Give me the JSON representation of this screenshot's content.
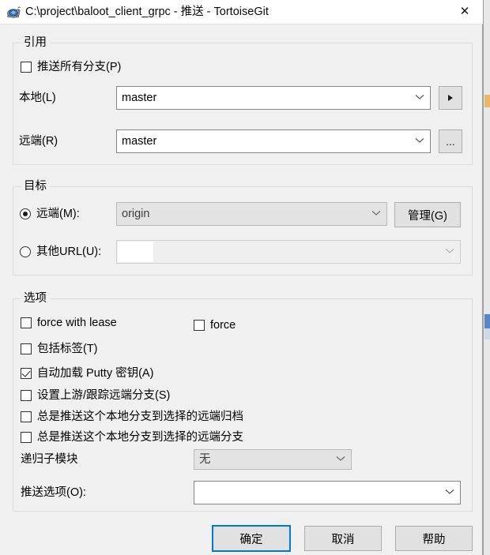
{
  "window": {
    "title": "C:\\project\\baloot_client_grpc - 推送 - TortoiseGit",
    "icon": "tortoisegit-turtle-icon",
    "close_label": "✕"
  },
  "refs_group": {
    "legend": "引用",
    "push_all_branches": {
      "label": "推送所有分支(P)",
      "checked": false
    },
    "local": {
      "label": "本地(L)",
      "value": "master",
      "button_label": "▶"
    },
    "remote": {
      "label": "远端(R)",
      "value": "master",
      "button_label": "..."
    }
  },
  "destination_group": {
    "legend": "目标",
    "remote_radio": {
      "label": "远端(M):",
      "selected": true,
      "value": "origin"
    },
    "manage_button": "管理(G)",
    "url_radio": {
      "label": "其他URL(U):",
      "selected": false,
      "value": ""
    }
  },
  "options_group": {
    "legend": "选项",
    "force_with_lease": {
      "label": "force with lease",
      "checked": false
    },
    "force": {
      "label": "force",
      "checked": false
    },
    "include_tags": {
      "label": "包括标签(T)",
      "checked": false
    },
    "autoload_putty_key": {
      "label": "自动加载 Putty 密钥(A)",
      "checked": true
    },
    "set_upstream": {
      "label": "设置上游/跟踪远端分支(S)",
      "checked": false
    },
    "always_push_to_archive": {
      "label": "总是推送这个本地分支到选择的远端归档",
      "checked": false
    },
    "always_push_to_branch": {
      "label": "总是推送这个本地分支到选择的远端分支",
      "checked": false
    },
    "recurse_submodules": {
      "label": "递归子模块",
      "value": "无"
    },
    "push_options": {
      "label": "推送选项(O):",
      "value": ""
    }
  },
  "footer": {
    "ok": "确定",
    "cancel": "取消",
    "help": "帮助"
  },
  "colors": {
    "accent": "#0078d7",
    "dialog_bg": "#f0f0f0",
    "button_face": "#e1e1e1",
    "disabled_field": "#e3e3e3"
  }
}
